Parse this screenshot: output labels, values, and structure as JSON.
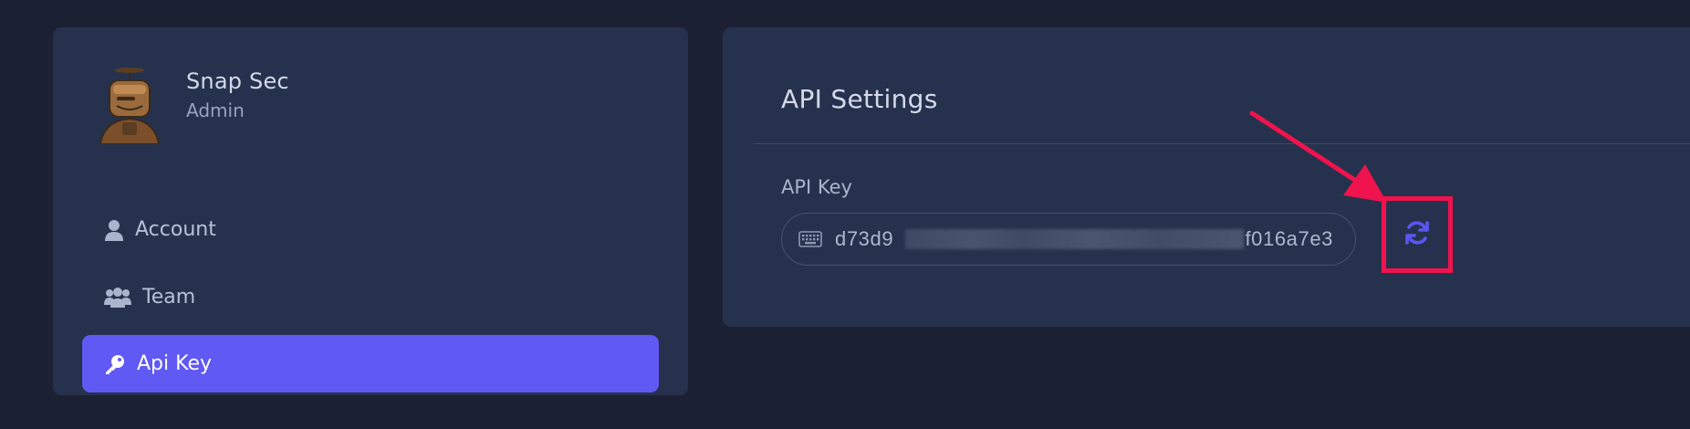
{
  "profile": {
    "name": "Snap Sec",
    "role": "Admin",
    "avatar_icon": "robot-avatar"
  },
  "sidebar": {
    "items": [
      {
        "label": "Account",
        "icon": "user-icon",
        "active": false
      },
      {
        "label": "Team",
        "icon": "users-icon",
        "active": false
      },
      {
        "label": "Api Key",
        "icon": "key-icon",
        "active": true
      }
    ]
  },
  "main": {
    "title": "API Settings",
    "api_key": {
      "label": "API Key",
      "value_prefix": "d73d9",
      "value_suffix": "f016a7e3",
      "masked": true,
      "icon": "keyboard-icon"
    },
    "refresh": {
      "icon": "refresh-icon"
    }
  },
  "colors": {
    "background": "#1b2033",
    "card": "#26324d",
    "accent": "#6059f3",
    "annotation": "#f0134d"
  }
}
